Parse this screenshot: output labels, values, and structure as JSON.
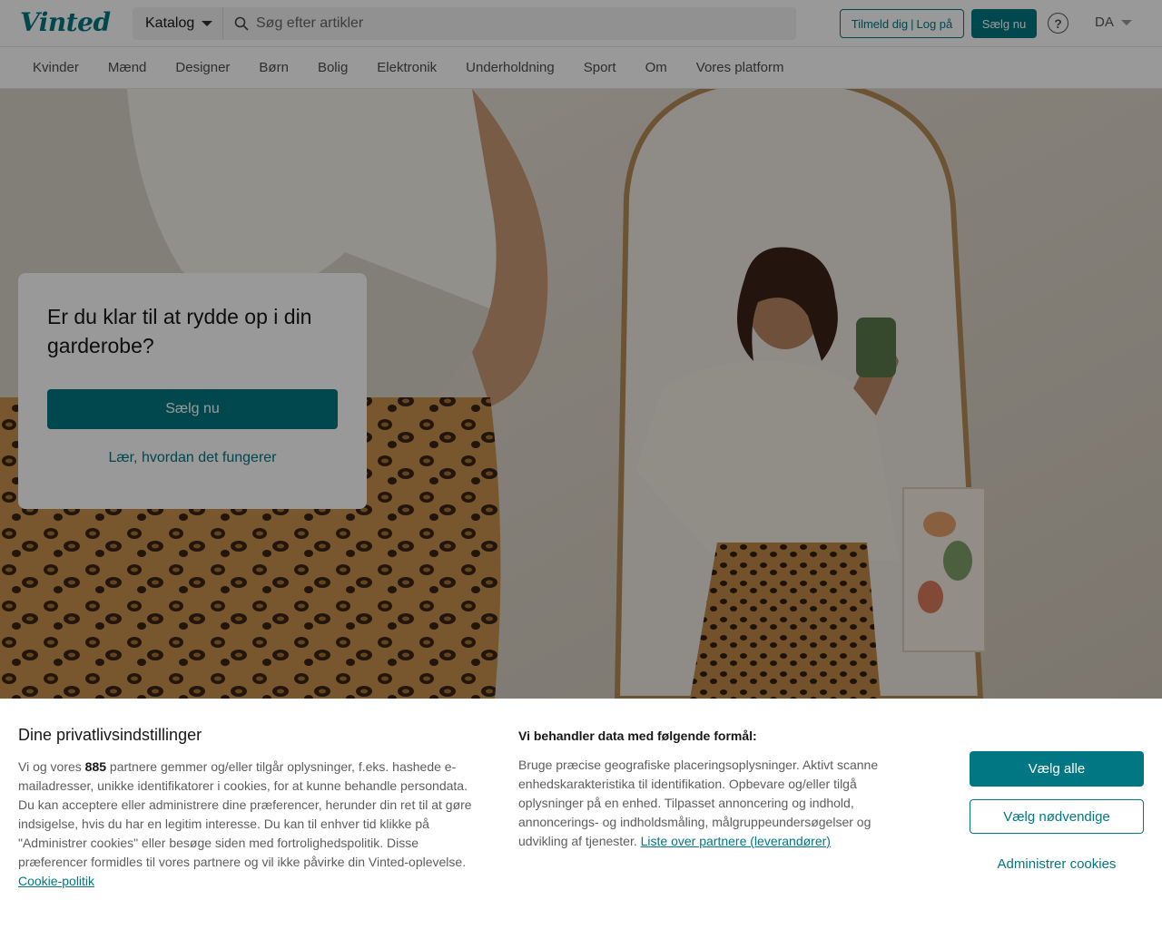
{
  "header": {
    "logo": "Vinted",
    "catalog_label": "Katalog",
    "search_placeholder": "Søg efter artikler",
    "signup_label": "Tilmeld dig",
    "login_label": "Log på",
    "login_separator": "|",
    "sell_label": "Sælg nu",
    "help_glyph": "?",
    "language": "DA"
  },
  "nav": {
    "items": [
      "Kvinder",
      "Mænd",
      "Designer",
      "Børn",
      "Bolig",
      "Elektronik",
      "Underholdning",
      "Sport",
      "Om",
      "Vores platform"
    ]
  },
  "hero": {
    "title": "Er du klar til at rydde op i din garderobe?",
    "sell_button": "Sælg nu",
    "learn_link": "Lær, hvordan det fungerer"
  },
  "cookie": {
    "title": "Dine privatlivsindstillinger",
    "text_before": "Vi og vores",
    "partner_count": "885",
    "text_after": "partnere gemmer og/eller tilgår oplysninger, f.eks. hashede e-mailadresser, unikke identifikatorer i cookies, for at kunne behandle persondata. Du kan acceptere eller administrere dine præferencer, herunder din ret til at gøre indsigelse, hvis du har en legitim interesse. Du kan til enhver tid klikke på \"Administrer cookies\" eller besøge siden med fortrolighedspolitik. Disse præferencer formidles til vores partnere og vil ikke påvirke din Vinted-oplevelse.",
    "policy_link": "Cookie-politik",
    "purposes_title": "Vi behandler data med følgende formål:",
    "purposes_text": "Bruge præcise geografiske placeringsoplysninger. Aktivt scanne enhedskarakteristika til identifikation. Opbevare og/eller tilgå oplysninger på en enhed. Tilpasset annoncering og indhold, annoncerings- og indholdsmåling, målgruppeundersøgelser og udvikling af tjenester.",
    "partners_link": "Liste over partnere (leverandører)",
    "accept_all": "Vælg alle",
    "necessary_only": "Vælg nødvendige",
    "manage": "Administrer cookies"
  },
  "colors": {
    "brand": "#007782",
    "text": "#171717",
    "muted": "#5c5c5c"
  },
  "icons": {
    "search": "search-icon",
    "help": "help-icon",
    "caret": "chevron-down-icon"
  }
}
